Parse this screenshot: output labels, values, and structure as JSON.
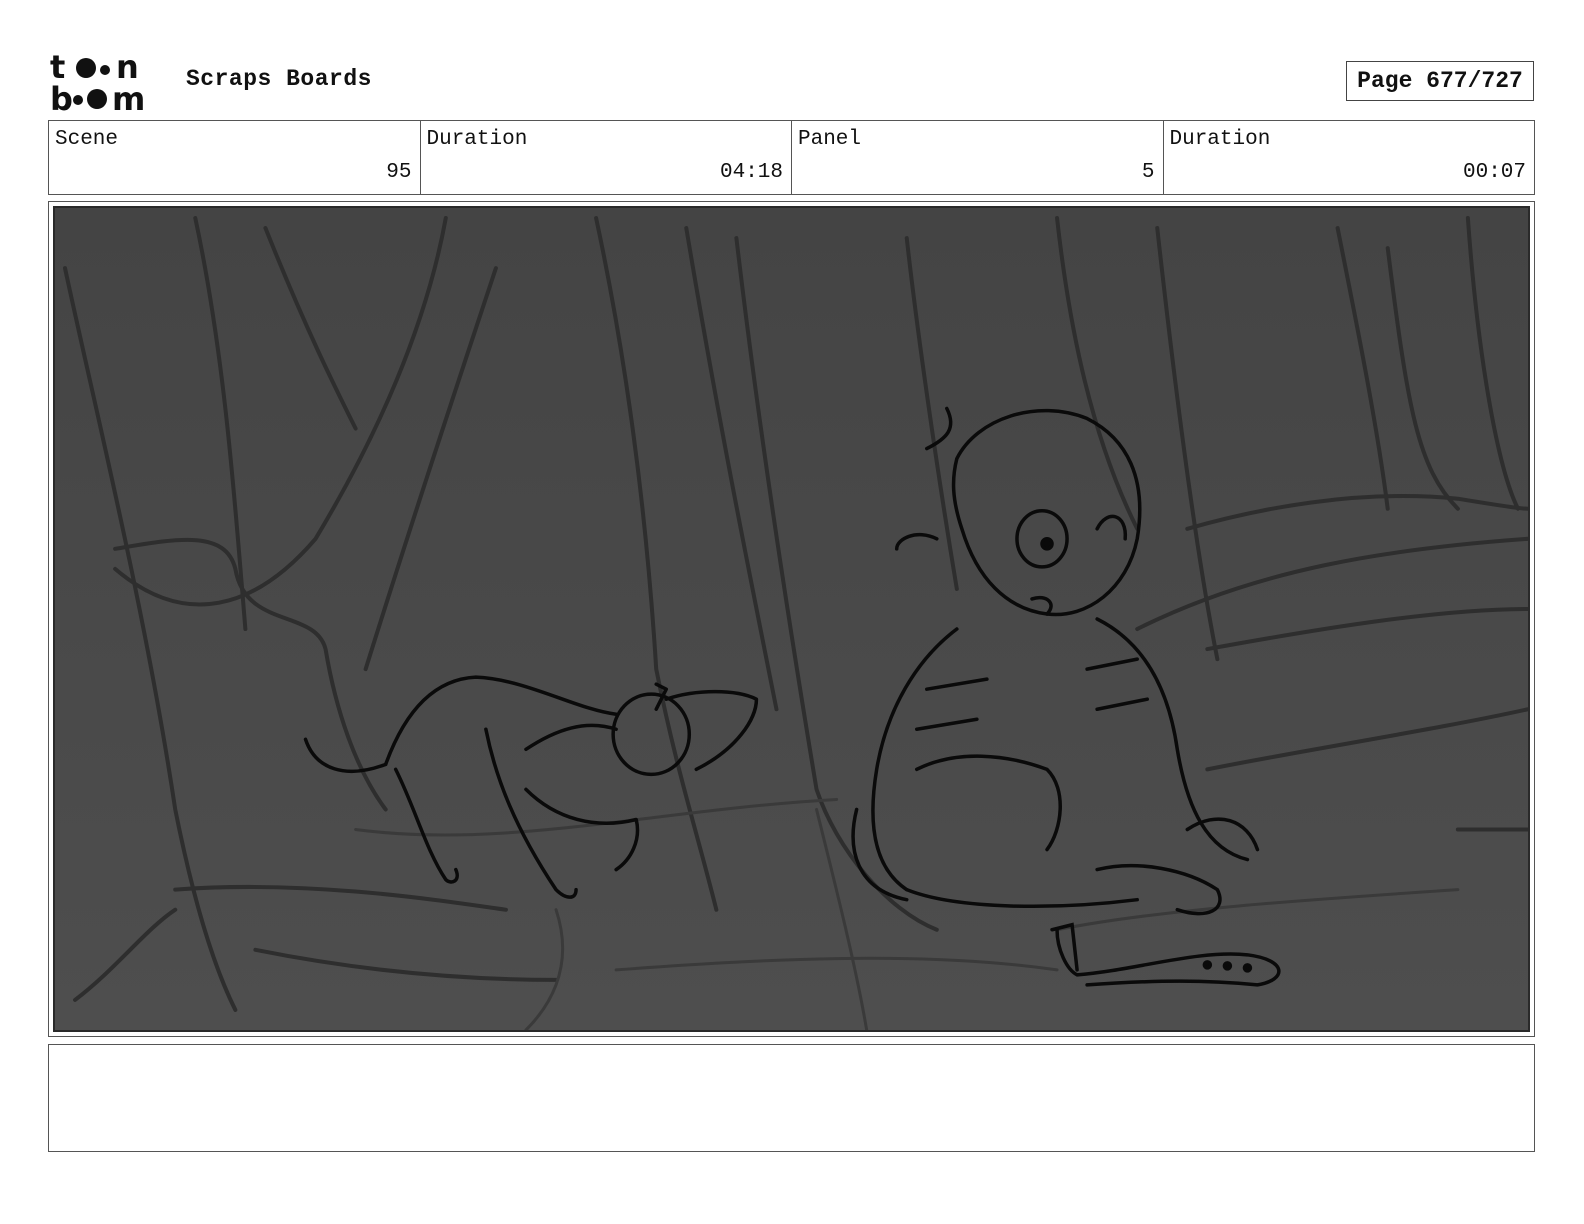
{
  "header": {
    "logo_text": "toon boom",
    "title": "Scraps Boards",
    "page_label": "Page 677/727"
  },
  "info": {
    "scene_label": "Scene",
    "scene_value": "95",
    "scene_duration_label": "Duration",
    "scene_duration_value": "04:18",
    "panel_label": "Panel",
    "panel_value": "5",
    "panel_duration_label": "Duration",
    "panel_duration_value": "00:07"
  },
  "panel": {
    "image_description": "storyboard-sketch-forest-girl-and-dog",
    "background_color": "#4a4a4a"
  },
  "notes": {
    "text": ""
  }
}
